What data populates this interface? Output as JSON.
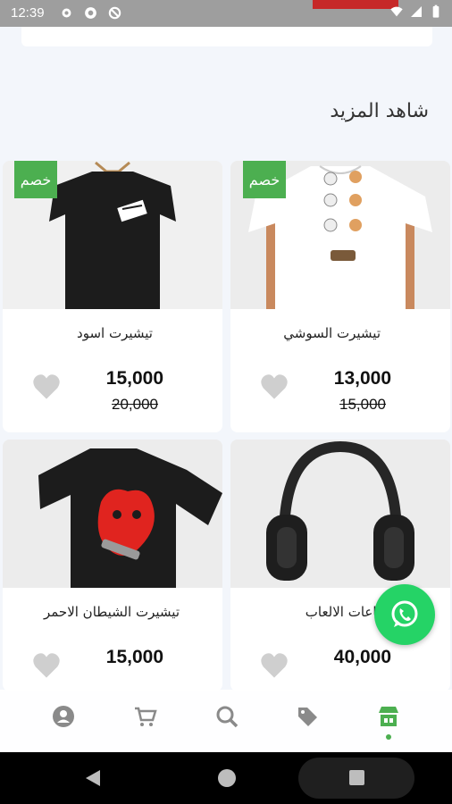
{
  "status_bar": {
    "time": "12:39"
  },
  "section": {
    "title": "شاهد المزيد"
  },
  "products": [
    {
      "name": "تيشيرت السوشي",
      "price": "13,000",
      "old_price": "15,000",
      "badge": "خصم",
      "image_icon": "tshirt-white-sushi"
    },
    {
      "name": "تيشيرت اسود",
      "price": "15,000",
      "old_price": "20,000",
      "badge": "خصم",
      "image_icon": "tshirt-black"
    },
    {
      "name": "ماعات الالعاب",
      "price": "40,000",
      "image_icon": "gaming-headphones"
    },
    {
      "name": "تيشيرت الشيطان الاحمر",
      "price": "15,000",
      "image_icon": "tshirt-red-devil"
    }
  ],
  "bottom_nav": {
    "items": [
      "store",
      "offers",
      "search",
      "cart",
      "profile"
    ],
    "active": "store"
  },
  "colors": {
    "accent": "#4caf50",
    "whatsapp": "#25d366"
  }
}
